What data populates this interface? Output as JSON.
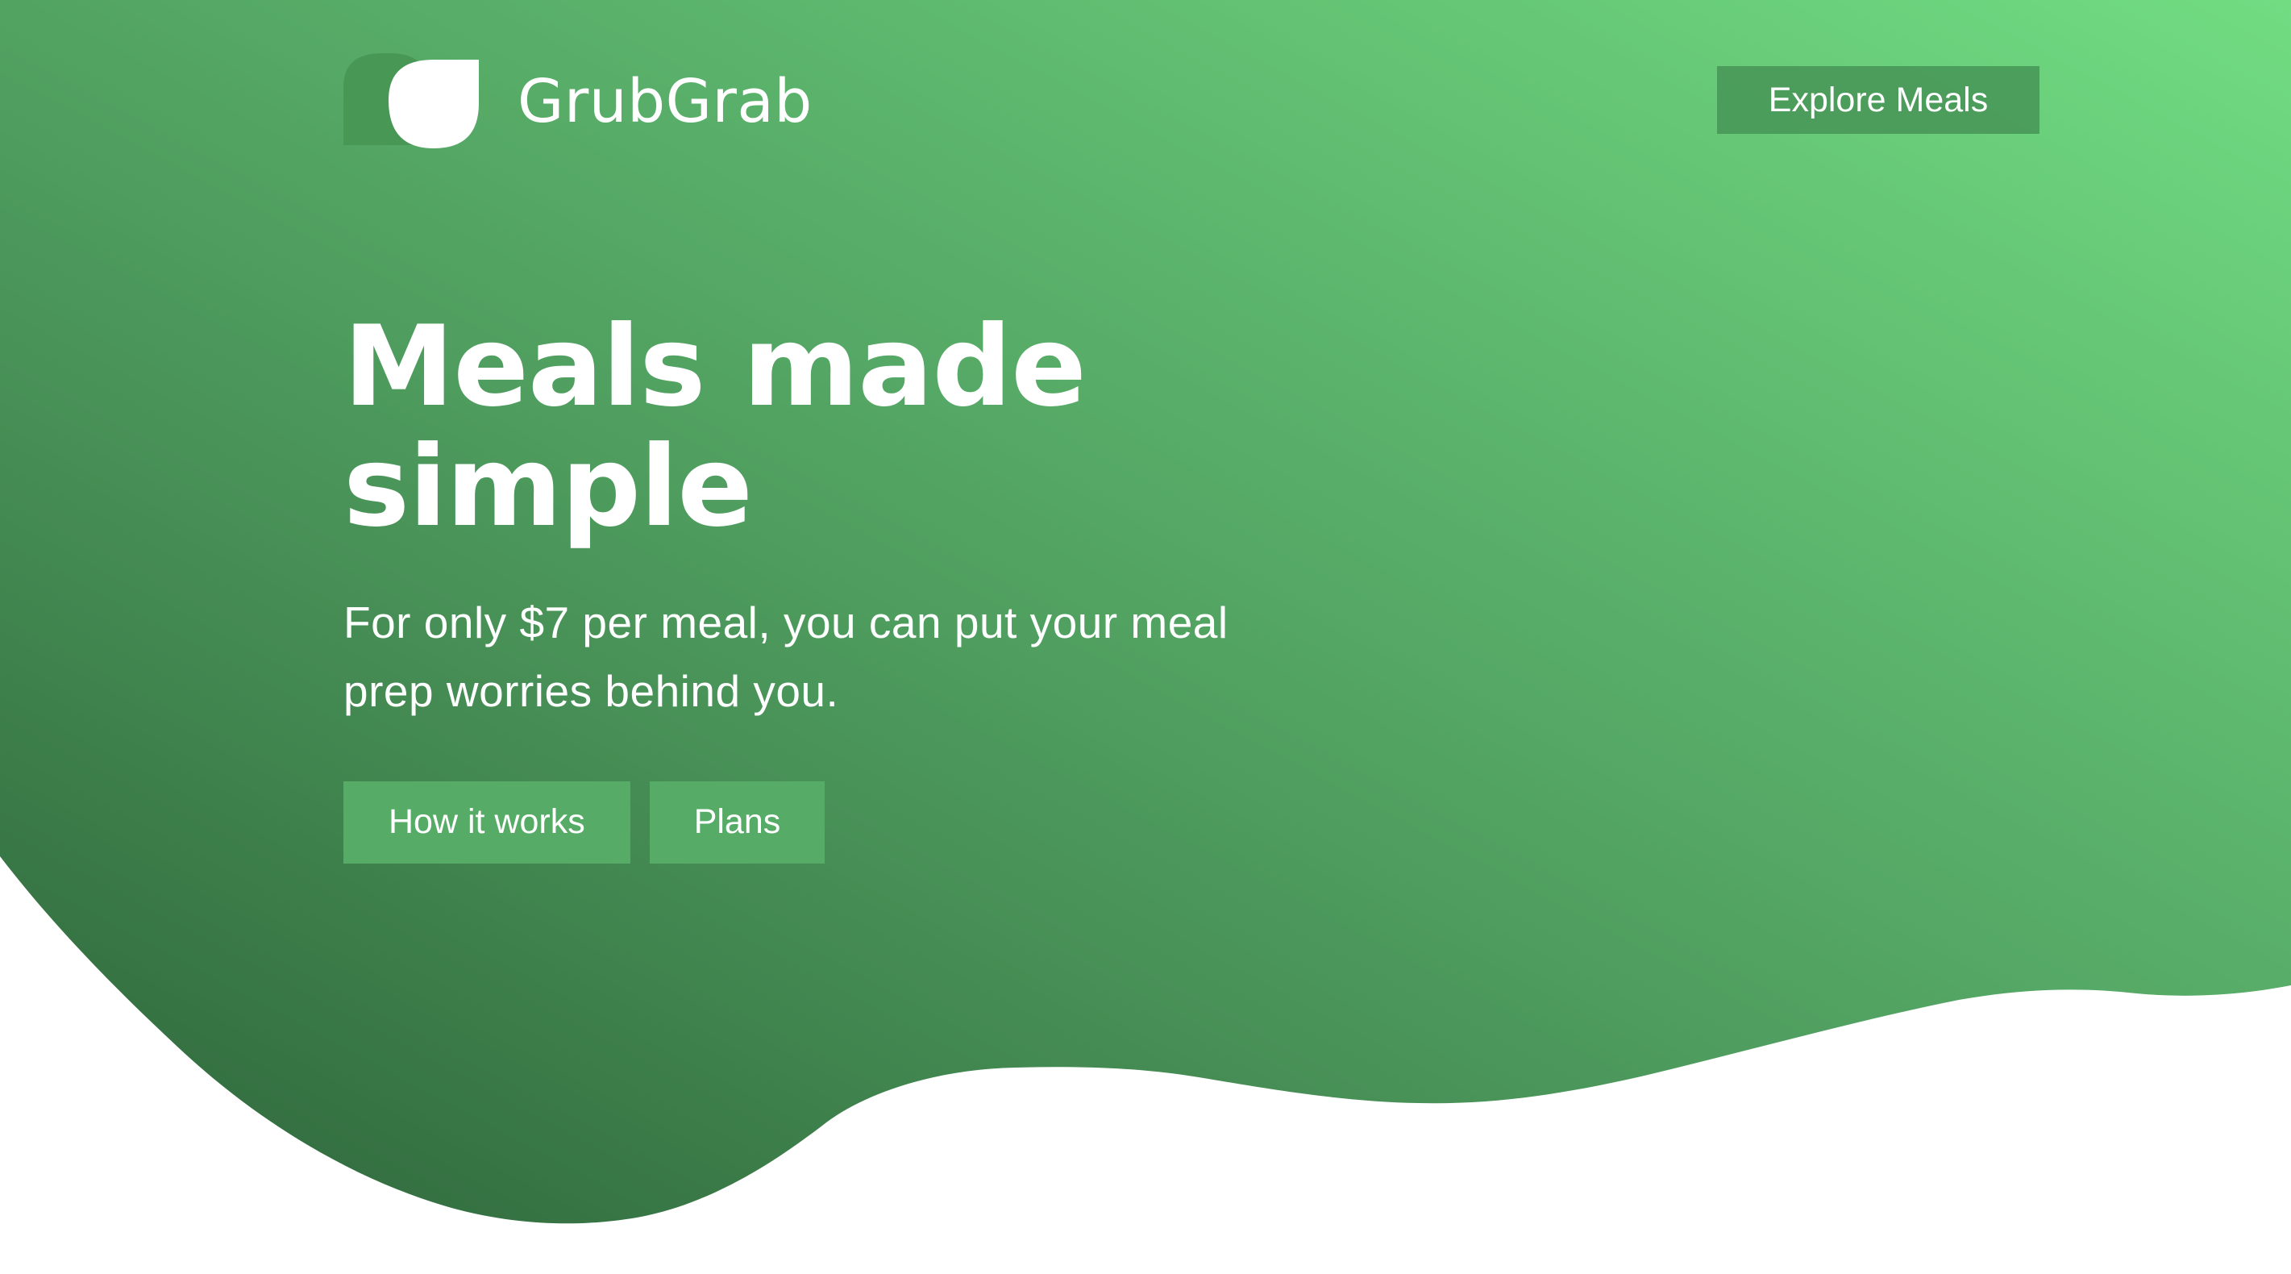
{
  "brand": {
    "name": "GrubGrab"
  },
  "header": {
    "explore_label": "Explore Meals"
  },
  "hero": {
    "title": "Meals made simple",
    "subtitle": "For only $7 per meal, you can put your meal prep worries behind you.",
    "buttons": [
      {
        "label": "How it works"
      },
      {
        "label": "Plans"
      }
    ]
  },
  "colors": {
    "gradient_top_right": "#6ed67f",
    "gradient_mid": "#55a866",
    "gradient_bottom_left": "#2d6439",
    "button_bg": "#57ae68",
    "text_on_hero": "#ffffff",
    "page_background": "#ffffff"
  },
  "icons": {
    "logo": "leaf-icon"
  }
}
